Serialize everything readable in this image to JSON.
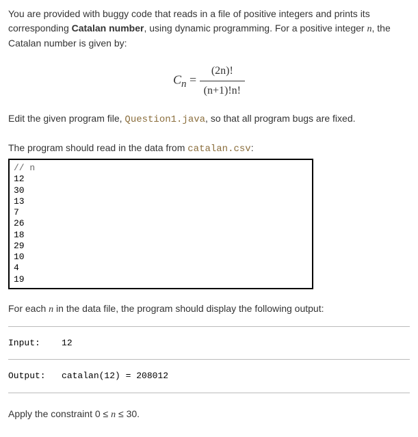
{
  "intro": {
    "part1": "You are provided with buggy code that reads in a file of positive integers and prints its corresponding ",
    "bold1": "Catalan number",
    "part2": ", using dynamic programming. For a positive integer ",
    "n": "n",
    "part3": ", the Catalan number is given by:"
  },
  "formula": {
    "C": "C",
    "sub": "n",
    "eq": " = ",
    "num": "(2n)!",
    "den": "(n+1)!n!"
  },
  "edit": {
    "part1": "Edit the given program file, ",
    "file": "Question1.java",
    "part2": ", so that all program bugs are fixed."
  },
  "read": {
    "part1": "The program should read in the data from ",
    "file": "catalan.csv",
    "part2": ":"
  },
  "csv": {
    "header": "// n",
    "lines": [
      "12",
      "30",
      "13",
      "7",
      "26",
      "18",
      "29",
      "10",
      "4",
      "19"
    ]
  },
  "foreach": {
    "part1": "For each ",
    "n": "n",
    "part2": " in the data file, the program should display the following output:"
  },
  "io": {
    "inputLabel": "Input:",
    "inputValue": "12",
    "outputLabel": "Output:",
    "outputValue": "catalan(12) = 208012"
  },
  "constraint": {
    "part1": "Apply the constraint 0  ≤ ",
    "n": "n",
    "part2": "  ≤  30."
  }
}
